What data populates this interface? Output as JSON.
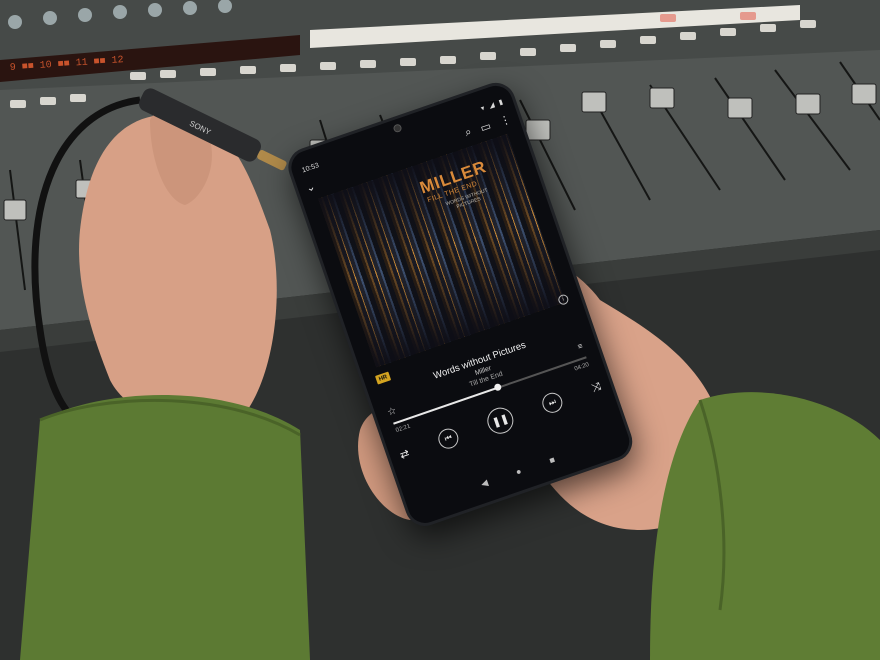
{
  "scene": {
    "colors": {
      "console": "#4b4e4c",
      "console_dark": "#2c2e2d",
      "sleeve": "#5d7a33",
      "skin": "#d9a48a",
      "accent_gold": "#d98a3a"
    }
  },
  "adapter": {
    "brand": "SONY"
  },
  "mixer": {
    "display_text": "9 ■■ 10 ■■ 11 ■■ 12"
  },
  "phone": {
    "status": {
      "time": "10:53"
    },
    "album_art": {
      "title": "MILLER",
      "subtitle": "FILL THE END",
      "small_text": "WORDS WITHOUT PICTURES"
    },
    "player": {
      "hires_badge": "HR",
      "song_title": "Words without Pictures",
      "artist": "Miller",
      "album": "Till the End",
      "time_elapsed": "02:21",
      "time_total": "04:20",
      "progress": 0.54
    },
    "icons": {
      "back": "chevron-down-icon",
      "search": "search-icon",
      "menu": "more-vert-icon",
      "favorite": "star-icon",
      "equalizer": "equalizer-icon",
      "previous": "skip-previous-icon",
      "play_pause": "pause-icon",
      "next": "skip-next-icon",
      "shuffle": "shuffle-icon",
      "repeat": "repeat-icon"
    }
  }
}
